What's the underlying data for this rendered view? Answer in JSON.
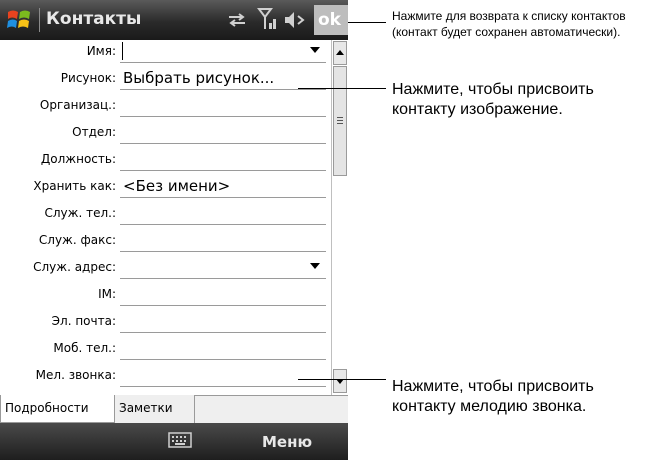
{
  "title_bar": {
    "app_title": "Контакты",
    "ok_label": "ok",
    "icons": [
      "windows-start-icon",
      "sync-icon",
      "signal-icon",
      "volume-icon"
    ]
  },
  "form": {
    "fields": [
      {
        "label": "Имя:",
        "value": "",
        "dropdown": true,
        "focused": true
      },
      {
        "label": "Рисунок:",
        "value": "Выбрать рисунок...",
        "dropdown": false
      },
      {
        "label": "Организац.:",
        "value": "",
        "dropdown": false
      },
      {
        "label": "Отдел:",
        "value": "",
        "dropdown": false
      },
      {
        "label": "Должность:",
        "value": "",
        "dropdown": false
      },
      {
        "label": "Хранить как:",
        "value": "<Без имени>",
        "dropdown": false
      },
      {
        "label": "Служ. тел.:",
        "value": "",
        "dropdown": false
      },
      {
        "label": "Служ. факс:",
        "value": "",
        "dropdown": false
      },
      {
        "label": "Служ. адрес:",
        "value": "",
        "dropdown": true
      },
      {
        "label": "IM:",
        "value": "",
        "dropdown": false
      },
      {
        "label": "Эл. почта:",
        "value": "",
        "dropdown": false
      },
      {
        "label": "Моб. тел.:",
        "value": "",
        "dropdown": false
      },
      {
        "label": "Мел. звонка:",
        "value": "",
        "dropdown": false
      }
    ]
  },
  "tabs": [
    {
      "label": "Подробности",
      "active": true
    },
    {
      "label": "Заметки",
      "active": false
    }
  ],
  "softkeys": {
    "right": "Меню",
    "keyboard_icon": "keyboard-icon"
  },
  "callouts": {
    "ok_note": "Нажмите для возврата к списку контактов (контакт будет сохранен автоматически).",
    "picture_note": "Нажмите, чтобы присвоить контакту изображение.",
    "ringtone_note": "Нажмите, чтобы присвоить контакту мелодию звонка."
  }
}
